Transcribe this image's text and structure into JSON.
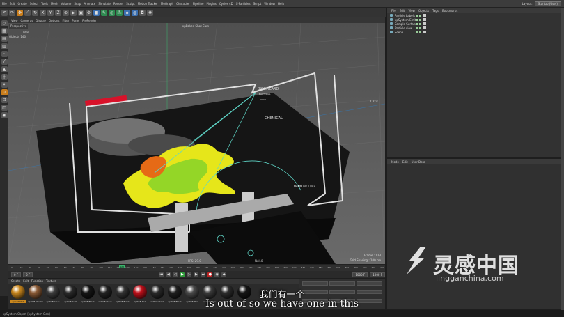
{
  "menubar": {
    "items": [
      "File",
      "Edit",
      "Create",
      "Select",
      "Tools",
      "Mesh",
      "Volume",
      "Snap",
      "Animate",
      "Simulate",
      "Render",
      "Sculpt",
      "Motion Tracker",
      "MoGraph",
      "Character",
      "Pipeline",
      "Plugins",
      "Cycles 4D",
      "X-Particles",
      "Script",
      "Window",
      "Help"
    ],
    "layout_label": "Layout:",
    "layout_value": "Startup (User)"
  },
  "viewport": {
    "menu": [
      "View",
      "Cameras",
      "Display",
      "Options",
      "Filter",
      "Panel",
      "ProRender"
    ],
    "hud_mode": "Perspective",
    "hud_total": "Total",
    "hud_objects": "Objects  140",
    "camera_label": "xpBaked Shot Cam",
    "frame_readout": "Frame : 123",
    "grid_readout": "Grid Spacing : 100 cm",
    "axis_label": "X Axis",
    "bottom_label_left": "FPS: 29.0",
    "bottom_label_right": "Null.8",
    "hologram": {
      "biohazard": "BIOHAZARD",
      "bacterial": "BACTERIAL",
      "viral": "VIRAL",
      "chemical": "CHEMICAL",
      "nano": "NANO",
      "nano2": "FACTURE"
    }
  },
  "timeline": {
    "ticks": [
      "0",
      "10",
      "20",
      "30",
      "40",
      "50",
      "60",
      "70",
      "80",
      "90",
      "100",
      "110",
      "120",
      "130",
      "140",
      "150",
      "160",
      "170",
      "180",
      "190",
      "200",
      "210",
      "220",
      "230",
      "240",
      "250",
      "260",
      "270",
      "280",
      "290",
      "300",
      "310",
      "320",
      "330",
      "340",
      "350",
      "360",
      "370",
      "380",
      "390",
      "400",
      "410",
      "420"
    ],
    "current_frame": "123"
  },
  "transport": {
    "start": "0 F",
    "current": "0 F",
    "end": "1000 F",
    "end2": "1000 F"
  },
  "materials": {
    "menu": [
      "Create",
      "Edit",
      "Function",
      "Texture"
    ],
    "items": [
      {
        "name": "xpSurf MoS",
        "color": "#c9871e",
        "selected": true
      },
      {
        "name": "xpRGB Shader",
        "color": "#8a5a35"
      },
      {
        "name": "xpRGB Clear",
        "color": "#3c3c3c"
      },
      {
        "name": "xpRGB Surf",
        "color": "#2a2a2a"
      },
      {
        "name": "xpRGB Black",
        "color": "#151515"
      },
      {
        "name": "xpRGB Black",
        "color": "#222222"
      },
      {
        "name": "xpRGB Black",
        "color": "#333333"
      },
      {
        "name": "xpRGB Red",
        "color": "#c0101a"
      },
      {
        "name": "xpRGB Black",
        "color": "#292929"
      },
      {
        "name": "xpRGB Black",
        "color": "#1f1f1f"
      },
      {
        "name": "xpRGB Plas",
        "color": "#4a4a4a"
      },
      {
        "name": "xpRGB Pipe",
        "color": "#3a3a3a"
      },
      {
        "name": "xpRGB Mat",
        "color": "#2c2c2c"
      },
      {
        "name": "Mat",
        "color": "#151515"
      }
    ]
  },
  "status": "xpSystem Object [xpSystem Gen]",
  "object_manager": {
    "menu": [
      "File",
      "Edit",
      "View",
      "Objects",
      "Tags",
      "Bookmarks"
    ],
    "rows": [
      "Particle Labels",
      "xpSystem Emit",
      "Sample Surface",
      "Particle view",
      "Scene"
    ]
  },
  "attribute_manager": {
    "menu": [
      "Mode",
      "Edit",
      "User Data"
    ]
  },
  "watermark": {
    "brand_cn": "灵感中国",
    "url": "lingganchina.com"
  },
  "subtitles": {
    "cn": "我们有一个",
    "en": "Is out of so we have one in this"
  }
}
